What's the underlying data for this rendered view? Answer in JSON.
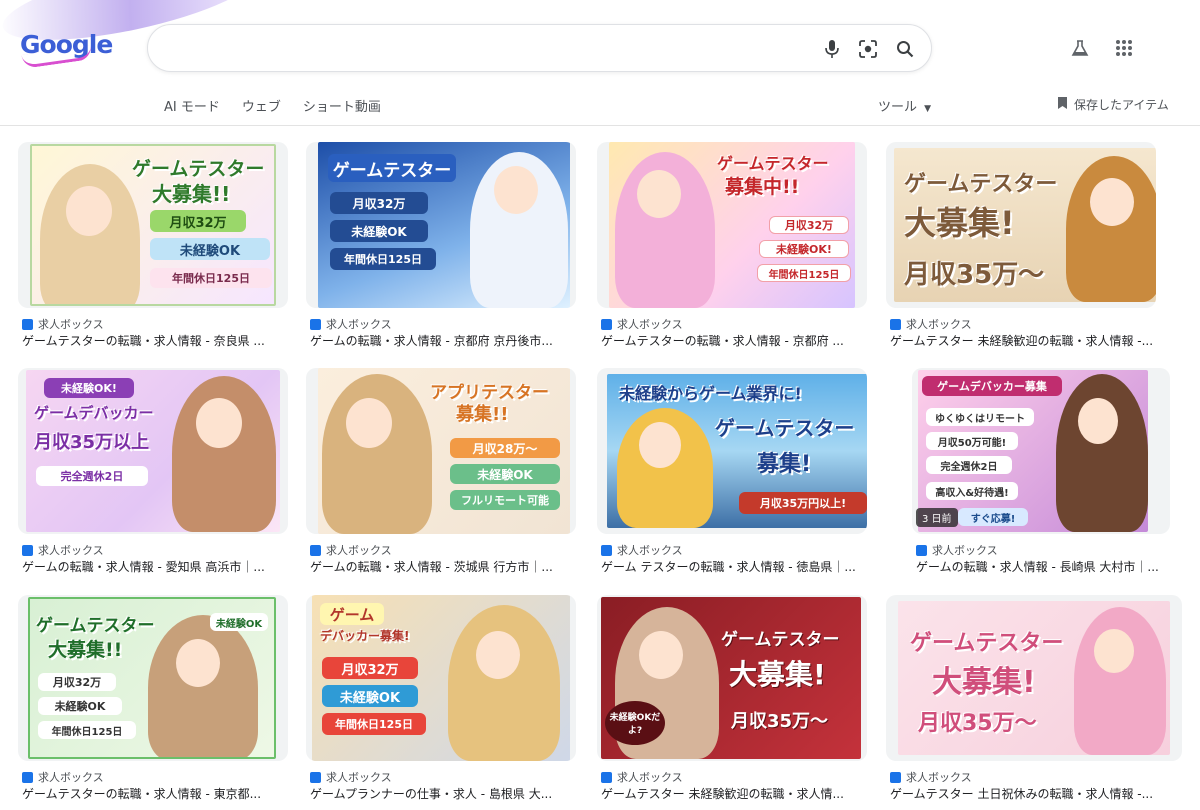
{
  "header": {
    "logo": "Google",
    "search": {
      "value": "",
      "placeholder": ""
    },
    "icons": [
      "mic-icon",
      "lens-icon",
      "search-icon",
      "labs-icon",
      "apps-icon"
    ],
    "tabs": [
      {
        "label": "AI モード"
      },
      {
        "label": "ウェブ"
      },
      {
        "label": "ショート動画"
      }
    ],
    "tools_label": "ツール",
    "saved_label": "保存したアイテム"
  },
  "results": [
    {
      "source": "求人ボックス",
      "title": "ゲームテスターの転職・求人情報 - 奈良県 ...",
      "texts": [
        "ゲームテスター",
        "大募集!!",
        "月収32万",
        "未経験OK",
        "年間休日125日"
      ]
    },
    {
      "source": "求人ボックス",
      "title": "ゲームの転職・求人情報 - 京都府 京丹後市...",
      "texts": [
        "ゲームテスター",
        "月収32万",
        "未経験OK",
        "年間休日125日"
      ]
    },
    {
      "source": "求人ボックス",
      "title": "ゲームテスターの転職・求人情報 - 京都府 ...",
      "texts": [
        "ゲームテスター",
        "募集中!!",
        "月収32万",
        "未経験OK!",
        "年間休日125日"
      ]
    },
    {
      "source": "求人ボックス",
      "title": "ゲームテスター 未経験歓迎の転職・求人情報 -...",
      "texts": [
        "ゲームテスター",
        "大募集!",
        "月収35万〜"
      ]
    },
    {
      "source": "求人ボックス",
      "title": "ゲームの転職・求人情報 - 愛知県 高浜市｜...",
      "texts": [
        "未経験OK!",
        "ゲームデバッカー",
        "月収35万以上",
        "完全週休2日"
      ]
    },
    {
      "source": "求人ボックス",
      "title": "ゲームの転職・求人情報 - 茨城県 行方市｜...",
      "texts": [
        "アプリテスター",
        "募集!!",
        "月収28万〜",
        "未経験OK",
        "フルリモート可能"
      ]
    },
    {
      "source": "求人ボックス",
      "title": "ゲーム テスターの転職・求人情報 - 徳島県｜...",
      "texts": [
        "未経験からゲーム業界に!",
        "ゲームテスター",
        "募集!",
        "月収35万円以上!"
      ]
    },
    {
      "source": "求人ボックス",
      "title": "ゲームの転職・求人情報 - 長崎県 大村市｜...",
      "texts": [
        "ゲームデバッカー募集",
        "ゆくゆくはリモート",
        "月収50万可能!",
        "完全週休2日",
        "高収入&好待遇!",
        "すぐ応募!"
      ],
      "badge": "3 日前"
    },
    {
      "source": "求人ボックス",
      "title": "ゲームテスターの転職・求人情報 - 東京都...",
      "texts": [
        "ゲームテスター",
        "大募集!!",
        "未経験OK",
        "月収32万",
        "未経験OK",
        "年間休日125日"
      ]
    },
    {
      "source": "求人ボックス",
      "title": "ゲームプランナーの仕事・求人 - 島根県 大...",
      "texts": [
        "ゲーム",
        "デバッカー募集!",
        "月収32万",
        "未経験OK",
        "年間休日125日"
      ]
    },
    {
      "source": "求人ボックス",
      "title": "ゲームテスター 未経験歓迎の転職・求人情...",
      "texts": [
        "ゲームテスター",
        "大募集!",
        "月収35万〜",
        "未経験OKだよ?"
      ]
    },
    {
      "source": "求人ボックス",
      "title": "ゲームテスター 土日祝休みの転職・求人情報 -...",
      "texts": [
        "ゲームテスター",
        "大募集!",
        "月収35万〜"
      ]
    }
  ]
}
